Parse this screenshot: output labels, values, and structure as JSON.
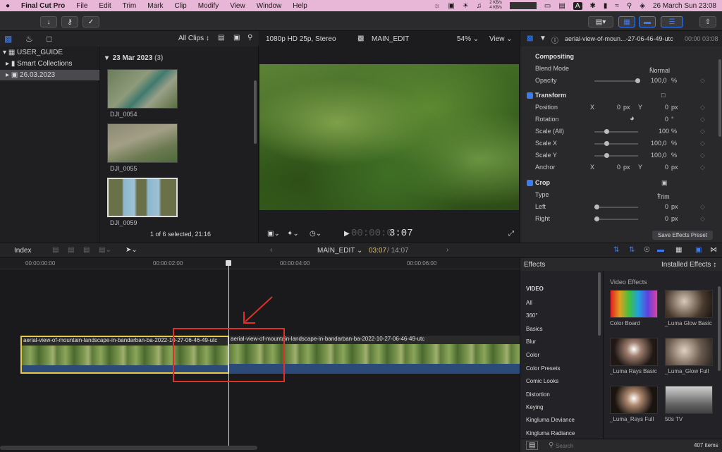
{
  "menubar": {
    "apple": "",
    "app": "Final Cut Pro",
    "items": [
      "File",
      "Edit",
      "Trim",
      "Mark",
      "Clip",
      "Modify",
      "View",
      "Window",
      "Help"
    ],
    "net_up": "2 KB/s",
    "net_down": "4 KB/s",
    "input_source": "A",
    "datetime": "26 March Sun  23:08"
  },
  "library": {
    "root": "USER_GUIDE",
    "items": [
      "Smart Collections",
      "26.03.2023"
    ]
  },
  "browser": {
    "filter": "All Clips",
    "date_group": "23 Mar 2023",
    "group_count": "(3)",
    "clips": [
      "DJI_0054",
      "DJI_0055",
      "DJI_0059"
    ],
    "status": "1 of 6 selected, 21:16"
  },
  "viewer": {
    "format": "1080p HD 25p, Stereo",
    "project": "MAIN_EDIT",
    "zoom": "54%",
    "view_menu": "View",
    "timecode_dim": "00:00:0",
    "timecode": "3:07"
  },
  "inspector": {
    "clip_name": "aerial-view-of-moun...-27-06-46-49-utc",
    "duration": "00:00 03:08",
    "compositing": "Compositing",
    "blend_mode_label": "Blend Mode",
    "blend_mode_value": "Normal",
    "opacity_label": "Opacity",
    "opacity_value": "100,0",
    "transform": "Transform",
    "position_label": "Position",
    "position_x": "0",
    "position_y": "0",
    "rotation_label": "Rotation",
    "rotation_value": "0",
    "scale_all_label": "Scale (All)",
    "scale_all_value": "100",
    "scale_x_label": "Scale X",
    "scale_x_value": "100,0",
    "scale_y_label": "Scale Y",
    "scale_y_value": "100,0",
    "anchor_label": "Anchor",
    "anchor_x": "0",
    "anchor_y": "0",
    "crop": "Crop",
    "type_label": "Type",
    "type_value": "Trim",
    "left_label": "Left",
    "left_value": "0",
    "right_label": "Right",
    "right_value": "0",
    "save_preset": "Save Effects Preset",
    "unit_px": "px",
    "unit_pct": "%",
    "unit_deg": "°",
    "axis_x": "X",
    "axis_y": "Y"
  },
  "timeline_bar": {
    "index": "Index",
    "project": "MAIN_EDIT",
    "position": "03:07",
    "total": "14:07"
  },
  "ruler": [
    "00:00:00:00",
    "00:00:02:00",
    "00:00:04:00",
    "00:00:06:00"
  ],
  "clips": [
    {
      "title": "aerial-view-of-mountain-landscape-in-bandarban-ba-2022-10-27-06-46-49-utc"
    },
    {
      "title": "aerial-view-of-mountain-landscape-in-bandarban-ba-2022-10-27-06-46-49-utc"
    }
  ],
  "effects": {
    "title": "Effects",
    "installed": "Installed Effects",
    "categories_header": "VIDEO",
    "categories": [
      "All",
      "360°",
      "Basics",
      "Blur",
      "Color",
      "Color Presets",
      "Comic Looks",
      "Distortion",
      "Keying",
      "Kingluma Deviance",
      "Kingluma Radiance"
    ],
    "section": "Video Effects",
    "items": [
      "Color Board",
      "_Luma Glow Basic",
      "_Luma Rays Basic",
      "_Luma_Glow Full",
      "_Luma_Rays Full",
      "50s TV"
    ],
    "search_placeholder": "Search",
    "count": "407 items"
  },
  "colors": {
    "accent": "#3b7df0",
    "selection_yellow": "#e6c84a",
    "annotation_red": "#e0302a",
    "clip_blue": "#2c4a78"
  }
}
